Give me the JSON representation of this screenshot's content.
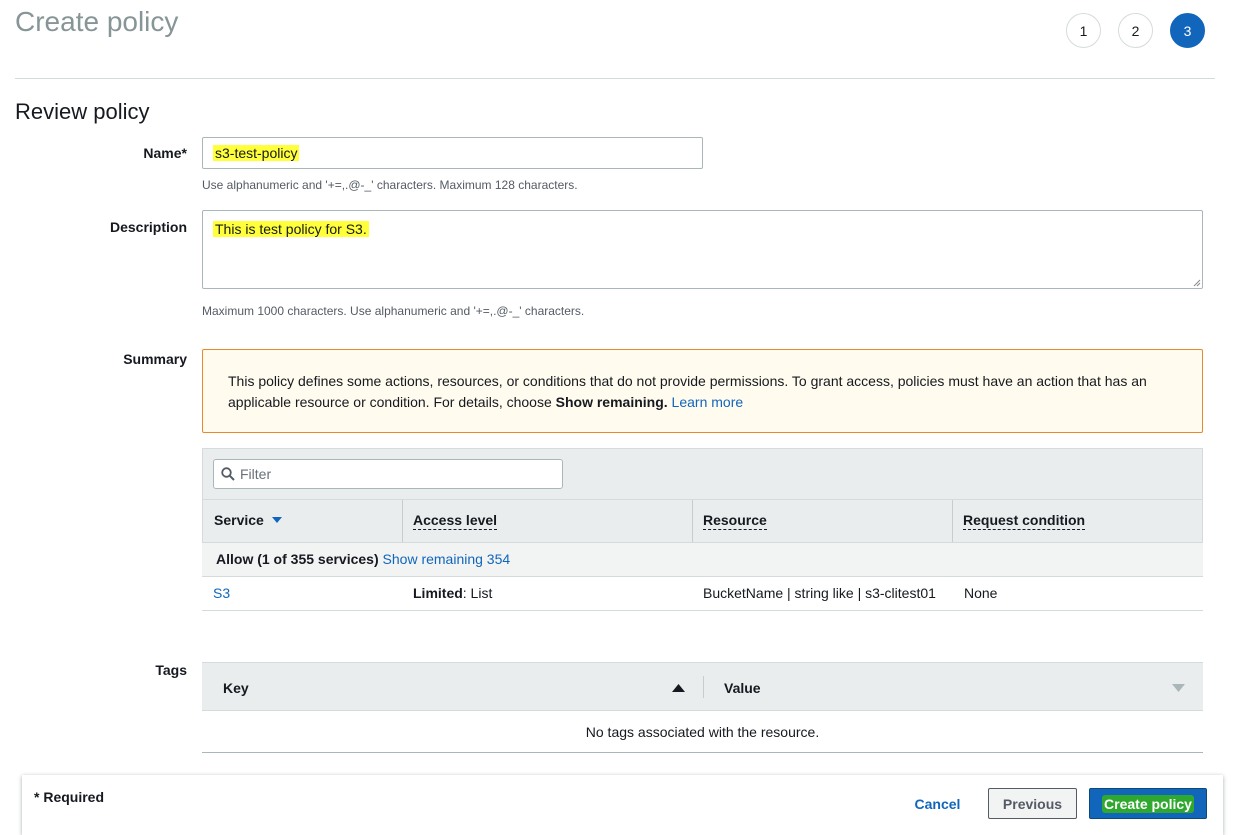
{
  "header": {
    "title": "Create policy",
    "steps": [
      "1",
      "2",
      "3"
    ],
    "active_step": 3
  },
  "review": {
    "title": "Review policy",
    "name": {
      "label": "Name*",
      "value": "s3-test-policy",
      "hint": "Use alphanumeric and '+=,.@-_' characters. Maximum 128 characters."
    },
    "description": {
      "label": "Description",
      "value": "This is test policy for S3.",
      "hint": "Maximum 1000 characters. Use alphanumeric and '+=,.@-_' characters."
    },
    "summary": {
      "label": "Summary",
      "notice_text": "This policy defines some actions, resources, or conditions that do not provide permissions. To grant access, policies must have an action that has an applicable resource or condition. For details, choose",
      "notice_bold": "Show remaining.",
      "notice_link": "Learn more",
      "filter_placeholder": "Filter",
      "columns": [
        "Service",
        "Access level",
        "Resource",
        "Request condition"
      ],
      "group_label": "Allow (1 of 355 services)",
      "group_link": "Show remaining 354",
      "rows": [
        {
          "service": "S3",
          "access_bold": "Limited",
          "access_rest": ": List",
          "resource": "BucketName | string like | s3-clitest01",
          "condition": "None"
        }
      ]
    },
    "tags": {
      "label": "Tags",
      "columns": [
        "Key",
        "Value"
      ],
      "empty": "No tags associated with the resource."
    }
  },
  "footer": {
    "required": "* Required",
    "cancel": "Cancel",
    "previous": "Previous",
    "create": "Create policy"
  },
  "colors": {
    "accent": "#1166bb",
    "highlight": "#ffff3a",
    "notice_border": "#e88a2c",
    "create_highlight": "#2fa82f"
  }
}
